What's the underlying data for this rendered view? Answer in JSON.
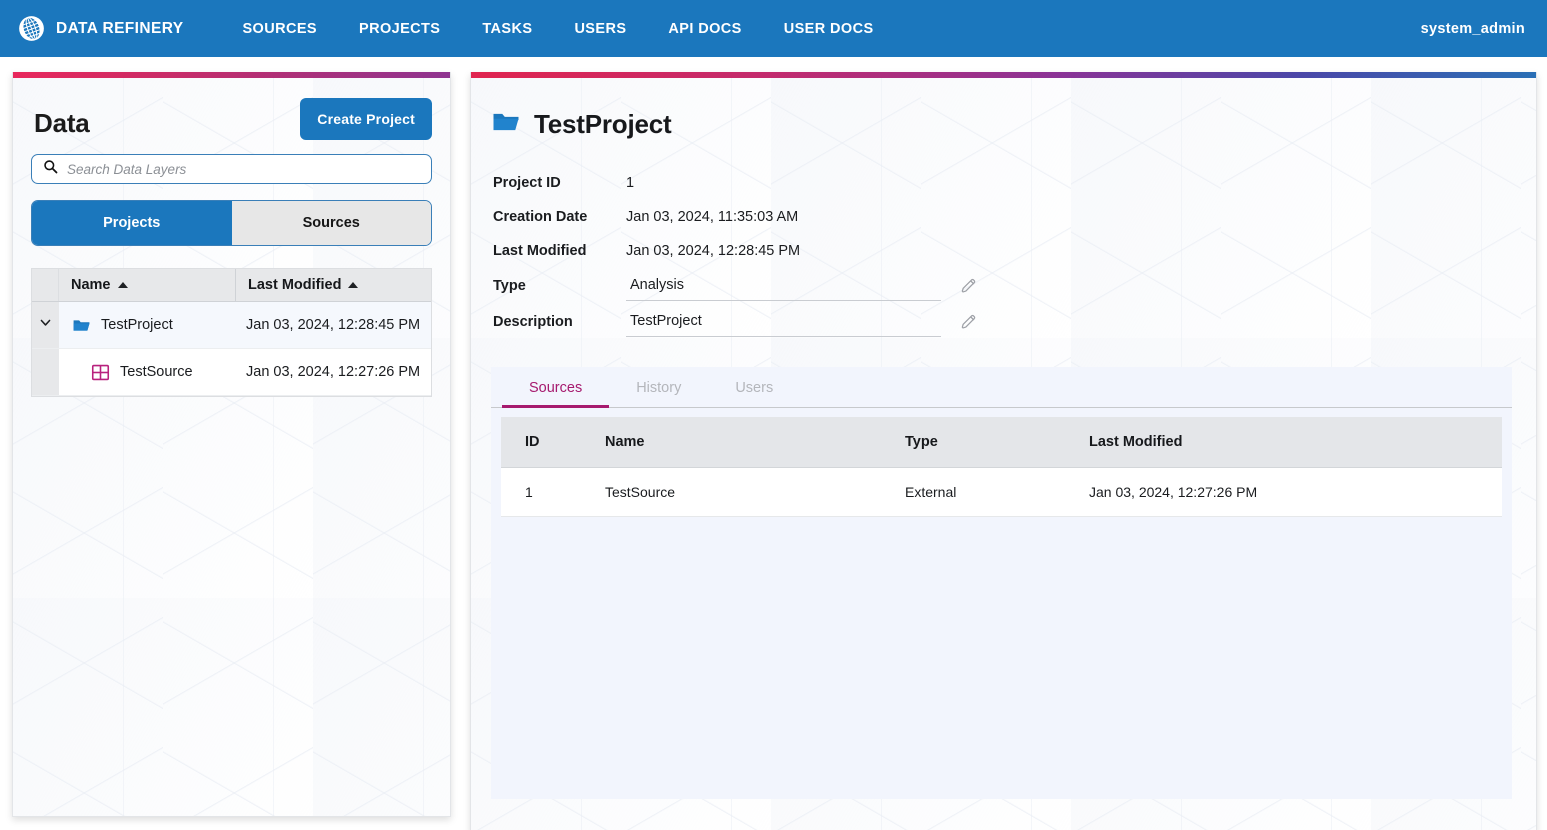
{
  "navbar": {
    "brand": "DATA REFINERY",
    "brand_icon": "globe-icon",
    "links": [
      {
        "label": "SOURCES"
      },
      {
        "label": "PROJECTS"
      },
      {
        "label": "TASKS"
      },
      {
        "label": "USERS"
      },
      {
        "label": "API DOCS"
      },
      {
        "label": "USER DOCS"
      }
    ],
    "user": "system_admin",
    "background_color": "#1b77bd"
  },
  "left_panel": {
    "accent_gradient": [
      "#e8275c",
      "#8e3490"
    ],
    "title": "Data",
    "create_button": "Create Project",
    "search": {
      "placeholder": "Search Data Layers",
      "value": "",
      "icon": "search-icon"
    },
    "segmented": {
      "options": [
        {
          "label": "Projects",
          "active": true
        },
        {
          "label": "Sources",
          "active": false
        }
      ]
    },
    "tree": {
      "columns": [
        {
          "label": "Name",
          "sort": "asc"
        },
        {
          "label": "Last Modified",
          "sort": "asc"
        }
      ],
      "rows": [
        {
          "name": "TestProject",
          "last_modified": "Jan 03, 2024, 12:28:45 PM",
          "icon": "folder-open-icon",
          "level": 0,
          "expanded": true,
          "selected": true
        },
        {
          "name": "TestSource",
          "last_modified": "Jan 03, 2024, 12:27:26 PM",
          "icon": "table-grid-icon",
          "level": 1,
          "expanded": false,
          "selected": false
        }
      ]
    }
  },
  "right_panel": {
    "accent_gradient": [
      "#e0244f",
      "#8b3396",
      "#2a6fb5"
    ],
    "header": {
      "icon": "folder-open-icon",
      "title": "TestProject"
    },
    "details": [
      {
        "label": "Project ID",
        "value": "1",
        "editable": false
      },
      {
        "label": "Creation Date",
        "value": "Jan 03, 2024, 11:35:03 AM",
        "editable": false
      },
      {
        "label": "Last Modified",
        "value": "Jan 03, 2024, 12:28:45 PM",
        "editable": false
      },
      {
        "label": "Type",
        "value": "Analysis",
        "editable": true
      },
      {
        "label": "Description",
        "value": "TestProject",
        "editable": true
      }
    ],
    "tabs": [
      {
        "label": "Sources",
        "active": true
      },
      {
        "label": "History",
        "active": false
      },
      {
        "label": "Users",
        "active": false
      }
    ],
    "sources_table": {
      "columns": [
        "ID",
        "Name",
        "Type",
        "Last Modified"
      ],
      "rows": [
        {
          "id": "1",
          "name": "TestSource",
          "type": "External",
          "last_modified": "Jan 03, 2024, 12:27:26 PM"
        }
      ]
    },
    "active_tab_color": "#a61a6e"
  }
}
